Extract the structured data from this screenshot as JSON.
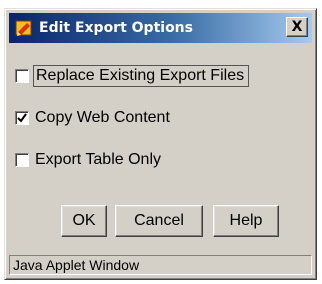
{
  "window": {
    "title": "Edit Export Options",
    "close_label": "X",
    "icon": "applet-icon",
    "title_gradient": [
      "#0a246a",
      "#a6caf0"
    ],
    "face_color": "#d4d0c8"
  },
  "options": [
    {
      "label": "Replace Existing Export Files",
      "checked": false,
      "focused": true
    },
    {
      "label": "Copy Web Content",
      "checked": true,
      "focused": false
    },
    {
      "label": "Export Table Only",
      "checked": false,
      "focused": false
    }
  ],
  "buttons": {
    "ok": "OK",
    "cancel": "Cancel",
    "help": "Help"
  },
  "status": {
    "text": "Java Applet Window"
  }
}
